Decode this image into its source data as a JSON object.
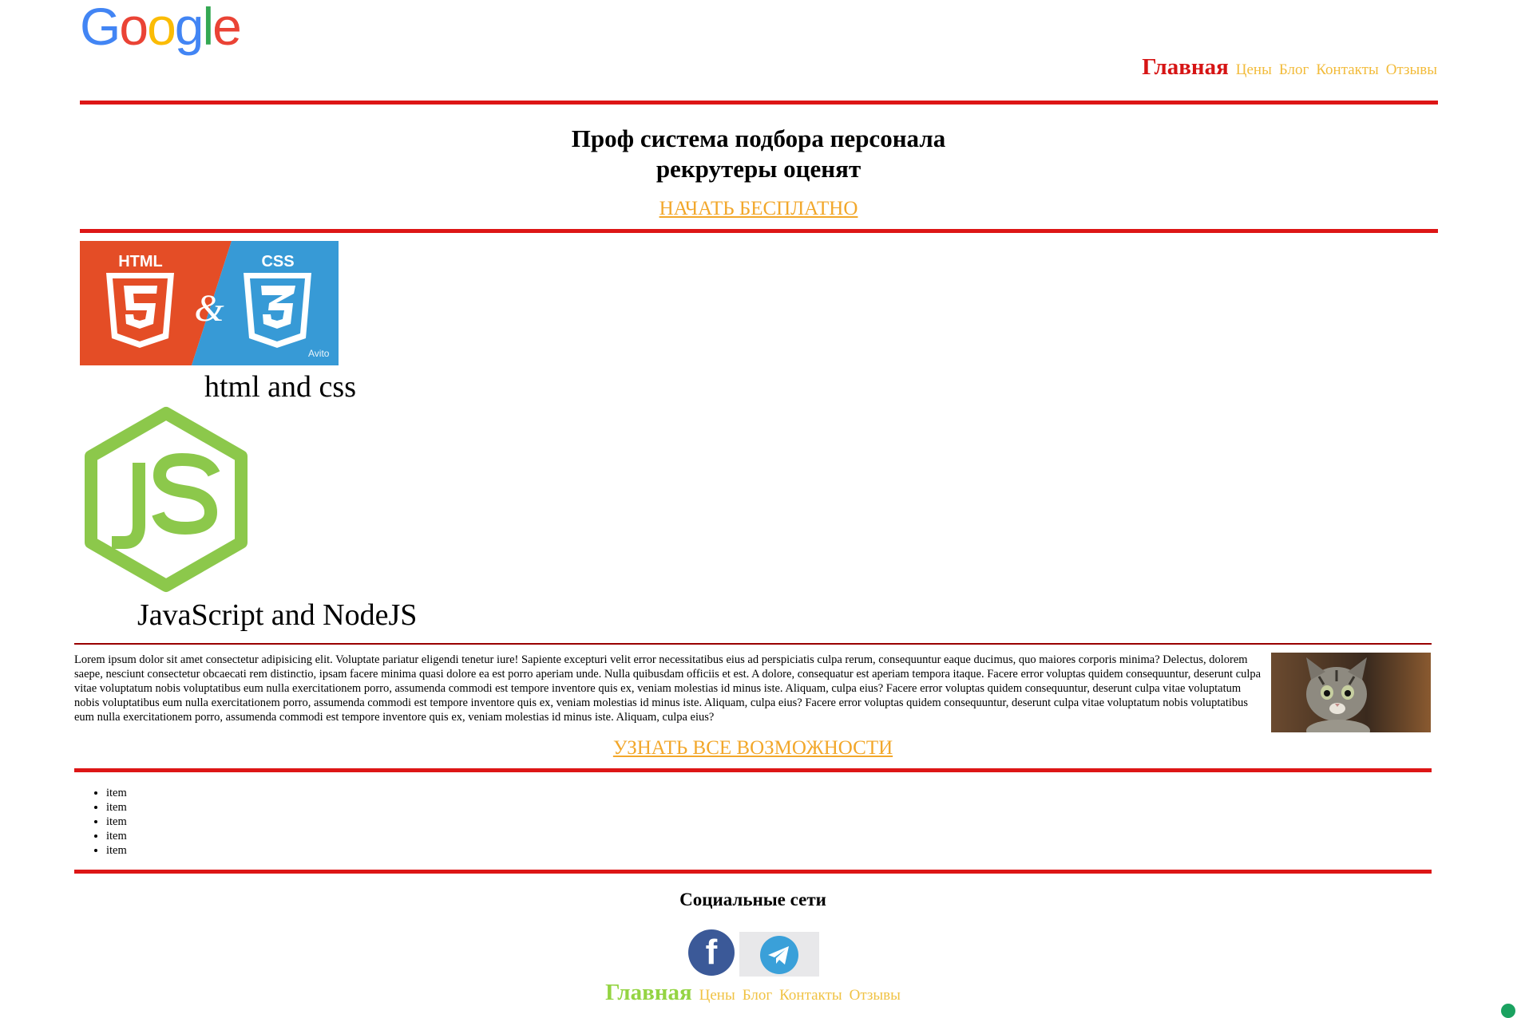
{
  "header": {
    "logo_text": "Google",
    "logo_letters": [
      {
        "ch": "G",
        "color": "#4285F4"
      },
      {
        "ch": "o",
        "color": "#EA4335"
      },
      {
        "ch": "o",
        "color": "#FBBC05"
      },
      {
        "ch": "g",
        "color": "#4285F4"
      },
      {
        "ch": "l",
        "color": "#34A853"
      },
      {
        "ch": "e",
        "color": "#EA4335"
      }
    ],
    "nav": {
      "active": "Главная",
      "links": [
        "Цены",
        "Блог",
        "Контакты",
        "Отзывы"
      ]
    }
  },
  "hero": {
    "title_line1": "Проф система подбора персонала",
    "title_line2": "рекрутеры оценят",
    "cta": "НАЧАТЬ БЕСПЛАТНО"
  },
  "banner": {
    "html_label": "HTML",
    "css_label": "CSS",
    "amp": "&",
    "watermark": "Avito"
  },
  "captions": {
    "html_css": "html and css",
    "js_node": "JavaScript and NodeJS"
  },
  "lorem": "Lorem ipsum dolor sit amet consectetur adipisicing elit. Voluptate pariatur eligendi tenetur iure! Sapiente excepturi velit error necessitatibus eius ad perspiciatis culpa rerum, consequuntur eaque ducimus, quo maiores corporis minima? Delectus, dolorem saepe, nesciunt consectetur obcaecati rem distinctio, ipsam facere minima quasi dolore ea est porro aperiam unde. Nulla quibusdam officiis et est. A dolore, consequatur est aperiam tempora itaque. Facere error voluptas quidem consequuntur, deserunt culpa vitae voluptatum nobis voluptatibus eum nulla exercitationem porro, assumenda commodi est tempore inventore quis ex, veniam molestias id minus iste. Aliquam, culpa eius? Facere error voluptas quidem consequuntur, deserunt culpa vitae voluptatum nobis voluptatibus eum nulla exercitationem porro, assumenda commodi est tempore inventore quis ex, veniam molestias id minus iste. Aliquam, culpa eius? Facere error voluptas quidem consequuntur, deserunt culpa vitae voluptatum nobis voluptatibus eum nulla exercitationem porro, assumenda commodi est tempore inventore quis ex, veniam molestias id minus iste. Aliquam, culpa eius?",
  "more_cta": "УЗНАТЬ ВСЕ ВОЗМОЖНОСТИ",
  "list_items": [
    "item",
    "item",
    "item",
    "item",
    "item"
  ],
  "social": {
    "title": "Социальные сети",
    "facebook_letter": "f"
  },
  "footer": {
    "nav": {
      "active": "Главная",
      "links": [
        "Цены",
        "Блог",
        "Контакты",
        "Отзывы"
      ]
    }
  },
  "colors": {
    "divider": "#dd1616",
    "nav_link": "#f2bb3a",
    "cta_link": "#f2a72a",
    "header_active": "#d61414",
    "footer_active": "#94d443"
  },
  "icons": [
    "html5-shield-icon",
    "css3-shield-icon",
    "nodejs-hexagon-icon",
    "facebook-icon",
    "telegram-icon"
  ]
}
